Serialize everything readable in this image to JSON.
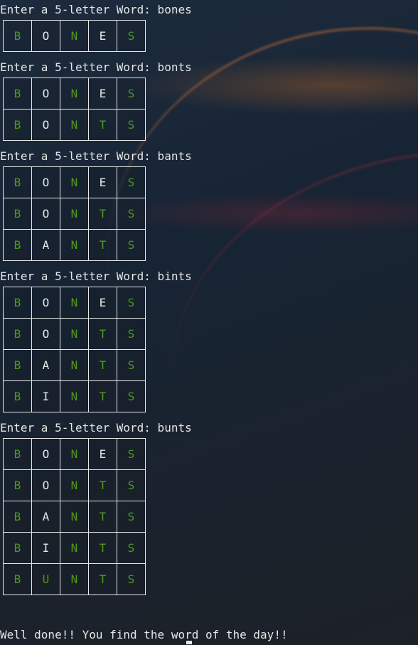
{
  "colors": {
    "correct": "#4e9a1a",
    "other": "#e6e6e6"
  },
  "turns": [
    {
      "prompt": "Enter a 5-letter Word: bones",
      "rows": [
        [
          {
            "l": "B",
            "c": 1
          },
          {
            "l": "O",
            "c": 0
          },
          {
            "l": "N",
            "c": 1
          },
          {
            "l": "E",
            "c": 0
          },
          {
            "l": "S",
            "c": 1
          }
        ]
      ]
    },
    {
      "prompt": "Enter a 5-letter Word: bonts",
      "rows": [
        [
          {
            "l": "B",
            "c": 1
          },
          {
            "l": "O",
            "c": 0
          },
          {
            "l": "N",
            "c": 1
          },
          {
            "l": "E",
            "c": 0
          },
          {
            "l": "S",
            "c": 1
          }
        ],
        [
          {
            "l": "B",
            "c": 1
          },
          {
            "l": "O",
            "c": 0
          },
          {
            "l": "N",
            "c": 1
          },
          {
            "l": "T",
            "c": 1
          },
          {
            "l": "S",
            "c": 1
          }
        ]
      ]
    },
    {
      "prompt": "Enter a 5-letter Word: bants",
      "rows": [
        [
          {
            "l": "B",
            "c": 1
          },
          {
            "l": "O",
            "c": 0
          },
          {
            "l": "N",
            "c": 1
          },
          {
            "l": "E",
            "c": 0
          },
          {
            "l": "S",
            "c": 1
          }
        ],
        [
          {
            "l": "B",
            "c": 1
          },
          {
            "l": "O",
            "c": 0
          },
          {
            "l": "N",
            "c": 1
          },
          {
            "l": "T",
            "c": 1
          },
          {
            "l": "S",
            "c": 1
          }
        ],
        [
          {
            "l": "B",
            "c": 1
          },
          {
            "l": "A",
            "c": 0
          },
          {
            "l": "N",
            "c": 1
          },
          {
            "l": "T",
            "c": 1
          },
          {
            "l": "S",
            "c": 1
          }
        ]
      ]
    },
    {
      "prompt": "Enter a 5-letter Word: bints",
      "rows": [
        [
          {
            "l": "B",
            "c": 1
          },
          {
            "l": "O",
            "c": 0
          },
          {
            "l": "N",
            "c": 1
          },
          {
            "l": "E",
            "c": 0
          },
          {
            "l": "S",
            "c": 1
          }
        ],
        [
          {
            "l": "B",
            "c": 1
          },
          {
            "l": "O",
            "c": 0
          },
          {
            "l": "N",
            "c": 1
          },
          {
            "l": "T",
            "c": 1
          },
          {
            "l": "S",
            "c": 1
          }
        ],
        [
          {
            "l": "B",
            "c": 1
          },
          {
            "l": "A",
            "c": 0
          },
          {
            "l": "N",
            "c": 1
          },
          {
            "l": "T",
            "c": 1
          },
          {
            "l": "S",
            "c": 1
          }
        ],
        [
          {
            "l": "B",
            "c": 1
          },
          {
            "l": "I",
            "c": 0
          },
          {
            "l": "N",
            "c": 1
          },
          {
            "l": "T",
            "c": 1
          },
          {
            "l": "S",
            "c": 1
          }
        ]
      ]
    },
    {
      "prompt": "Enter a 5-letter Word: bunts",
      "rows": [
        [
          {
            "l": "B",
            "c": 1
          },
          {
            "l": "O",
            "c": 0
          },
          {
            "l": "N",
            "c": 1
          },
          {
            "l": "E",
            "c": 0
          },
          {
            "l": "S",
            "c": 1
          }
        ],
        [
          {
            "l": "B",
            "c": 1
          },
          {
            "l": "O",
            "c": 0
          },
          {
            "l": "N",
            "c": 1
          },
          {
            "l": "T",
            "c": 1
          },
          {
            "l": "S",
            "c": 1
          }
        ],
        [
          {
            "l": "B",
            "c": 1
          },
          {
            "l": "A",
            "c": 0
          },
          {
            "l": "N",
            "c": 1
          },
          {
            "l": "T",
            "c": 1
          },
          {
            "l": "S",
            "c": 1
          }
        ],
        [
          {
            "l": "B",
            "c": 1
          },
          {
            "l": "I",
            "c": 0
          },
          {
            "l": "N",
            "c": 1
          },
          {
            "l": "T",
            "c": 1
          },
          {
            "l": "S",
            "c": 1
          }
        ],
        [
          {
            "l": "B",
            "c": 1
          },
          {
            "l": "U",
            "c": 1
          },
          {
            "l": "N",
            "c": 1
          },
          {
            "l": "T",
            "c": 1
          },
          {
            "l": "S",
            "c": 1
          }
        ]
      ]
    }
  ],
  "final_message": "Well done!! You find the word of the day!!"
}
